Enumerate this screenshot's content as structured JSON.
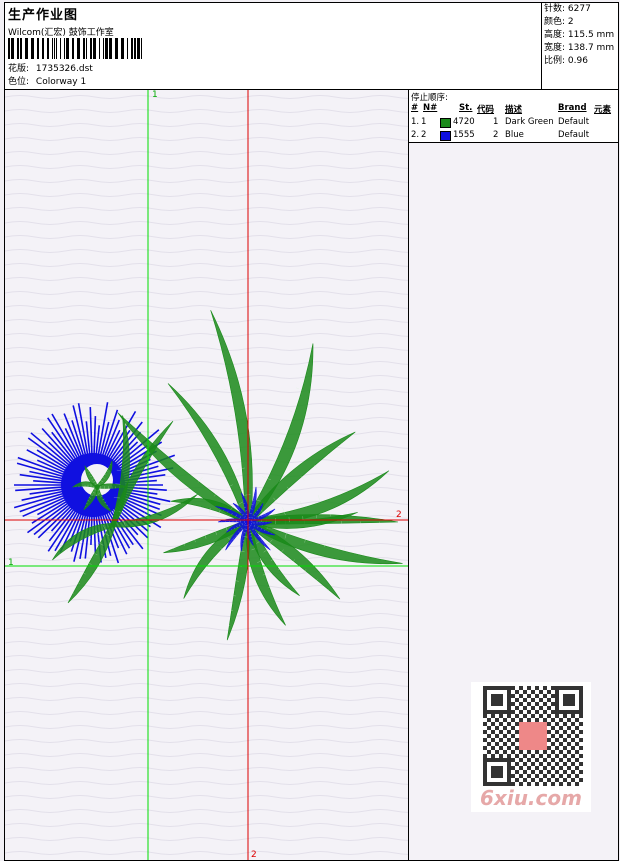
{
  "header": {
    "title": "生产作业图",
    "company": "Wilcom(汇宏) 鼓饰工作室",
    "design_label": "花版:",
    "design_value": "1735326.dst",
    "colorway_label": "色位:",
    "colorway_value": "Colorway 1"
  },
  "stats": [
    {
      "label": "针数:",
      "value": "6277"
    },
    {
      "label": "颜色:",
      "value": "2"
    },
    {
      "label": "高度:",
      "value": "115.5 mm"
    },
    {
      "label": "宽度:",
      "value": "138.7 mm"
    },
    {
      "label": "比例:",
      "value": "0.96"
    }
  ],
  "stop_table": {
    "caption": "停止顺序:",
    "headers": {
      "num": "#",
      "n": "N#",
      "st": "St.",
      "code": "代码",
      "desc": "描述",
      "brand": "Brand",
      "elem": "元素"
    },
    "rows": [
      {
        "num": "1.",
        "n": "1",
        "st": "4720",
        "code": "1",
        "desc": "Dark Green",
        "brand": "Default",
        "color": "#1a8a1a"
      },
      {
        "num": "2.",
        "n": "2",
        "st": "1555",
        "code": "2",
        "desc": "Blue",
        "brand": "Default",
        "color": "#1010e0"
      }
    ]
  },
  "axes": {
    "v1": "1",
    "h1": "1",
    "v2": "2",
    "h2": "2"
  },
  "colors": {
    "green": "#1a8a1a",
    "blue": "#1010e0",
    "axis1": "#00dd00",
    "axis2": "#dd0000"
  },
  "watermark": {
    "text": "6xiu.com"
  }
}
